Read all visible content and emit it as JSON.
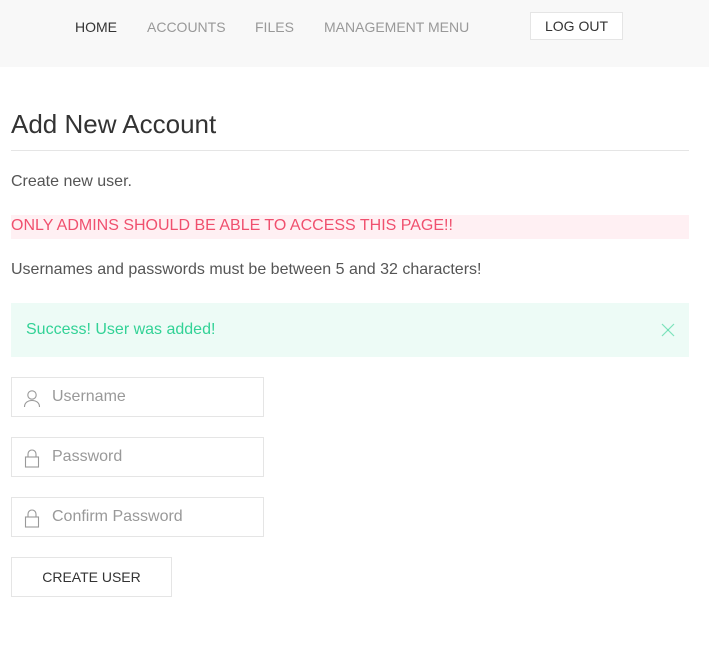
{
  "nav": {
    "items": [
      {
        "label": "HOME",
        "active": true
      },
      {
        "label": "ACCOUNTS",
        "active": false
      },
      {
        "label": "FILES",
        "active": false
      },
      {
        "label": "MANAGEMENT MENU",
        "active": false
      }
    ],
    "logout_label": "LOG OUT"
  },
  "page": {
    "title": "Add New Account",
    "subtitle": "Create new user.",
    "warning": "ONLY ADMINS SHOULD BE ABLE TO ACCESS THIS PAGE!!",
    "rules": "Usernames and passwords must be between 5 and 32 characters!"
  },
  "alert": {
    "message": "Success! User was added!",
    "close_icon": "close-icon"
  },
  "form": {
    "username": {
      "value": "",
      "placeholder": "Username",
      "icon": "user-icon"
    },
    "password": {
      "value": "",
      "placeholder": "Password",
      "icon": "lock-icon"
    },
    "confirm_password": {
      "value": "",
      "placeholder": "Confirm Password",
      "icon": "lock-icon"
    },
    "submit_label": "CREATE USER"
  },
  "colors": {
    "warning_text": "#f0506e",
    "warning_bg": "#fff0f3",
    "success_text": "#32d296",
    "success_bg": "#edfbf6",
    "navbar_bg": "#f8f8f8"
  }
}
